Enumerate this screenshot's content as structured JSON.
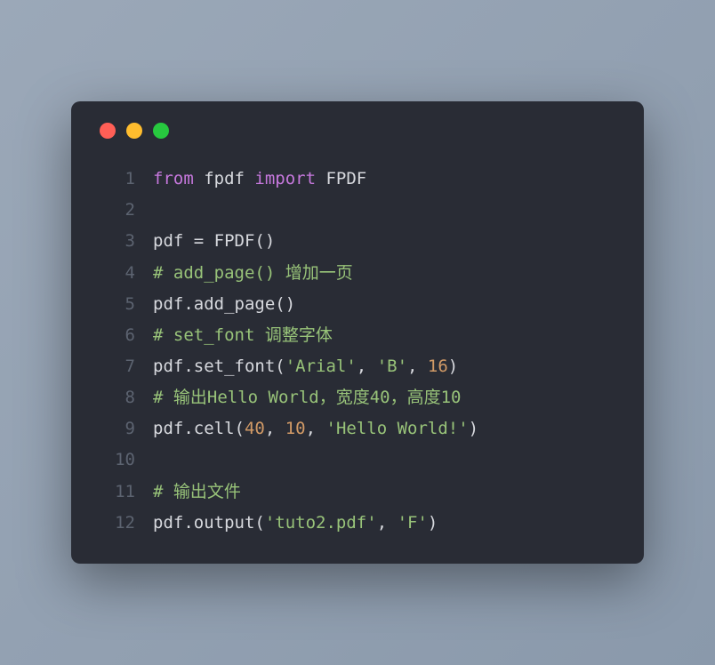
{
  "titlebar": {
    "dots": [
      "close",
      "minimize",
      "maximize"
    ]
  },
  "code": {
    "lines": [
      {
        "num": "1",
        "tokens": [
          {
            "cls": "tok-keyword",
            "t": "from"
          },
          {
            "cls": "tok-default",
            "t": " fpdf "
          },
          {
            "cls": "tok-keyword",
            "t": "import"
          },
          {
            "cls": "tok-default",
            "t": " FPDF"
          }
        ]
      },
      {
        "num": "2",
        "tokens": []
      },
      {
        "num": "3",
        "tokens": [
          {
            "cls": "tok-default",
            "t": "pdf = FPDF()"
          }
        ]
      },
      {
        "num": "4",
        "tokens": [
          {
            "cls": "tok-comment",
            "t": "# add_page() 增加一页"
          }
        ]
      },
      {
        "num": "5",
        "tokens": [
          {
            "cls": "tok-default",
            "t": "pdf.add_page()"
          }
        ]
      },
      {
        "num": "6",
        "tokens": [
          {
            "cls": "tok-comment",
            "t": "# set_font 调整字体"
          }
        ]
      },
      {
        "num": "7",
        "tokens": [
          {
            "cls": "tok-default",
            "t": "pdf.set_font("
          },
          {
            "cls": "tok-string",
            "t": "'Arial'"
          },
          {
            "cls": "tok-default",
            "t": ", "
          },
          {
            "cls": "tok-string",
            "t": "'B'"
          },
          {
            "cls": "tok-default",
            "t": ", "
          },
          {
            "cls": "tok-number",
            "t": "16"
          },
          {
            "cls": "tok-default",
            "t": ")"
          }
        ]
      },
      {
        "num": "8",
        "tokens": [
          {
            "cls": "tok-comment",
            "t": "# 输出Hello World，宽度40，高度10"
          }
        ]
      },
      {
        "num": "9",
        "tokens": [
          {
            "cls": "tok-default",
            "t": "pdf.cell("
          },
          {
            "cls": "tok-number",
            "t": "40"
          },
          {
            "cls": "tok-default",
            "t": ", "
          },
          {
            "cls": "tok-number",
            "t": "10"
          },
          {
            "cls": "tok-default",
            "t": ", "
          },
          {
            "cls": "tok-string",
            "t": "'Hello World!'"
          },
          {
            "cls": "tok-default",
            "t": ")"
          }
        ]
      },
      {
        "num": "10",
        "tokens": []
      },
      {
        "num": "11",
        "tokens": [
          {
            "cls": "tok-comment",
            "t": "# 输出文件"
          }
        ]
      },
      {
        "num": "12",
        "tokens": [
          {
            "cls": "tok-default",
            "t": "pdf.output("
          },
          {
            "cls": "tok-string",
            "t": "'tuto2.pdf'"
          },
          {
            "cls": "tok-default",
            "t": ", "
          },
          {
            "cls": "tok-string",
            "t": "'F'"
          },
          {
            "cls": "tok-default",
            "t": ")"
          }
        ]
      }
    ]
  }
}
